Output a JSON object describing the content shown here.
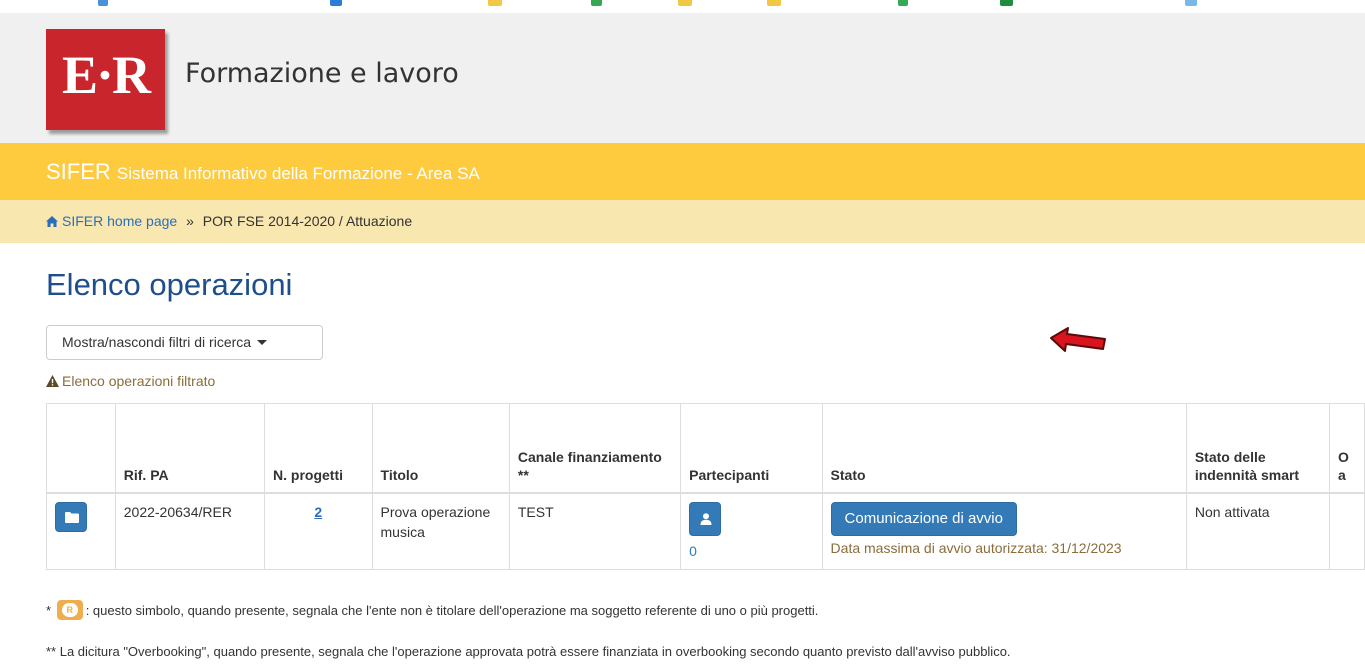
{
  "header": {
    "logo_text": "E·R",
    "site_title": "Formazione e lavoro"
  },
  "band": {
    "app_name": "SIFER",
    "app_desc": "Sistema Informativo della Formazione - Area SA"
  },
  "breadcrumb": {
    "home_label": "SIFER home page",
    "separator": "»",
    "current": "POR FSE 2014-2020 / Attuazione"
  },
  "page": {
    "title": "Elenco operazioni",
    "filter_toggle_label": "Mostra/nascondi filtri di ricerca",
    "filtered_note": "Elenco operazioni filtrato"
  },
  "table": {
    "headers": {
      "actions": "",
      "rif_pa": "Rif. PA",
      "n_progetti": "N. progetti",
      "titolo": "Titolo",
      "canale": "Canale finanziamento **",
      "partecipanti": "Partecipanti",
      "stato": "Stato",
      "stato_indennita": "Stato delle indennità smart",
      "extra": "O a"
    },
    "rows": [
      {
        "rif_pa": "2022-20634/RER",
        "n_progetti": "2",
        "titolo": "Prova operazione musica",
        "canale": "TEST",
        "partecipanti_count": "0",
        "stato_button": "Comunicazione di avvio",
        "stato_note": "Data massima di avvio autorizzata: 31/12/2023",
        "stato_indennita": "Non attivata",
        "extra": ""
      }
    ]
  },
  "footnotes": {
    "star_prefix": "*",
    "badge_letter": "R",
    "note1": ": questo simbolo, quando presente, segnala che l'ente non è titolare dell'operazione ma soggetto referente di uno o più progetti.",
    "note2": "** La dicitura \"Overbooking\", quando presente, segnala che l'operazione approvata potrà essere finanziata in overbooking secondo quanto previsto dall'avviso pubblico."
  },
  "colors": {
    "brand_red": "#c8262c",
    "band_yellow": "#fecb3f",
    "breadcrumb_bg": "#f9e7b0",
    "primary_blue": "#337ab7",
    "title_blue": "#1f4e8c",
    "annotation_arrow": "#d9141c"
  },
  "icons": {
    "home": "home-icon",
    "caret": "caret-down-icon",
    "warning": "warning-icon",
    "folder": "folder-icon",
    "user": "user-icon",
    "annotation": "red-arrow-icon"
  }
}
